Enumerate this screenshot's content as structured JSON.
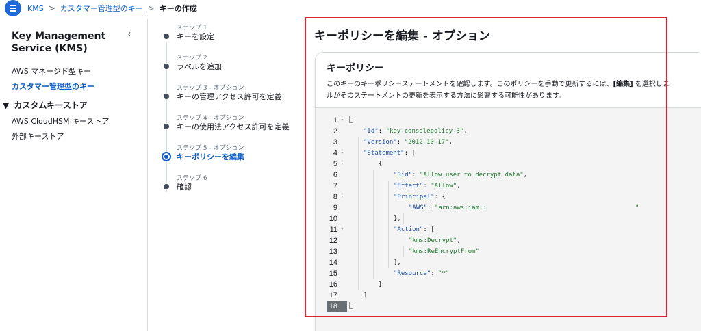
{
  "breadcrumb": {
    "items": [
      "KMS",
      "カスタマー管理型のキー"
    ],
    "current": "キーの作成",
    "separator": ">"
  },
  "sidebar": {
    "title": "Key Management Service (KMS)",
    "collapse_glyph": "‹",
    "items": [
      "AWS マネージド型キー",
      "カスタマー管理型のキー"
    ],
    "section": {
      "label": "カスタムキーストア",
      "expand_glyph": "▼",
      "items": [
        "AWS CloudHSM キーストア",
        "外部キーストア"
      ]
    }
  },
  "steps": [
    {
      "label": "ステップ 1",
      "name": "キーを設定"
    },
    {
      "label": "ステップ 2",
      "name": "ラベルを追加"
    },
    {
      "label": "ステップ 3 - オプション",
      "name": "キーの管理アクセス許可を定義"
    },
    {
      "label": "ステップ 4 - オプション",
      "name": "キーの使用法アクセス許可を定義"
    },
    {
      "label": "ステップ 5 - オプション",
      "name": "キーポリシーを編集"
    },
    {
      "label": "ステップ 6",
      "name": "確認"
    }
  ],
  "active_step": 5,
  "main": {
    "title": "キーポリシーを編集 - オプション",
    "card_title": "キーポリシー",
    "desc_line1_a": "このキーのキーポリシーステートメントを確認します。このポリシーを手動で更新するには、",
    "desc_line1_bold": "[編集]",
    "desc_line1_b": " を選択しま",
    "desc_line2": "ルがそのステートメントの更新を表示する方法に影響する可能性があります。"
  },
  "editor": {
    "line_numbers": [
      "1",
      "2",
      "3",
      "4",
      "5",
      "6",
      "7",
      "8",
      "9",
      "10",
      "11",
      "12",
      "13",
      "14",
      "15",
      "16",
      "17",
      "18"
    ],
    "active_line": 18,
    "fold_glyph": "▾",
    "code": {
      "l1": "{",
      "l2_key": "\"Id\"",
      "l2_val": "\"key-consolepolicy-3\"",
      "l3_key": "\"Version\"",
      "l3_val": "\"2012-10-17\"",
      "l4_key": "\"Statement\"",
      "l4_rest": ": [",
      "l5": "{",
      "l6_key": "\"Sid\"",
      "l6_val": "\"Allow user to decrypt data\"",
      "l7_key": "\"Effect\"",
      "l7_val": "\"Allow\"",
      "l8_key": "\"Principal\"",
      "l8_rest": ": {",
      "l9_key": "\"AWS\"",
      "l9_val": "\"arn:aws:iam::",
      "l9_end": "\"",
      "l10": "},",
      "l11_key": "\"Action\"",
      "l11_rest": ": [",
      "l12_val": "\"kms:Decrypt\"",
      "l13_val": "\"kms:ReEncryptFrom\"",
      "l14": "],",
      "l15_key": "\"Resource\"",
      "l15_val": "\"*\"",
      "l16": "}",
      "l17": "]",
      "l18": "}"
    }
  },
  "colors": {
    "accent": "#0a5bc4",
    "highlight_frame": "#e0242f",
    "json_key": "#1b4fa3",
    "json_string": "#1d7a2d"
  }
}
